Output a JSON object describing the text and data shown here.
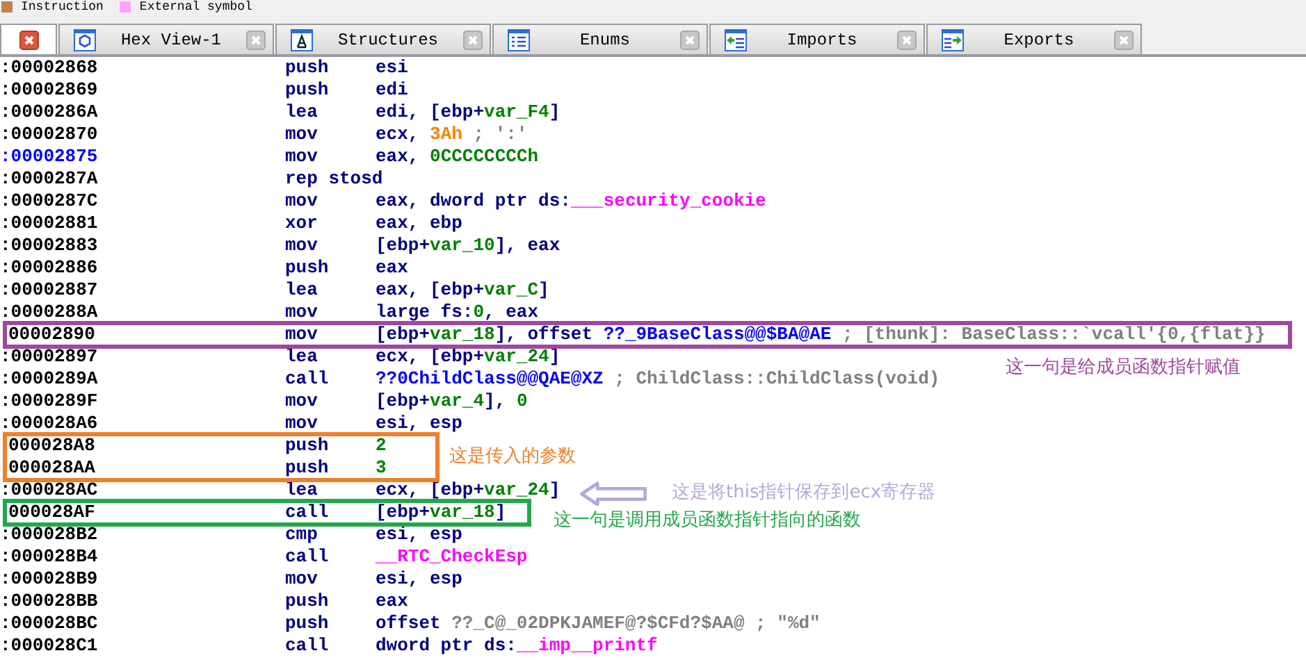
{
  "legend": [
    {
      "label": "Instruction",
      "color": "#c08050"
    },
    {
      "label": "External symbol",
      "color": "#ffa0ff"
    }
  ],
  "tabs": [
    {
      "kind": "disasm",
      "selected": true
    },
    {
      "kind": "hex",
      "label": "Hex View-1",
      "selected": false
    },
    {
      "kind": "structures",
      "label": "Structures",
      "selected": false
    },
    {
      "kind": "enums",
      "label": "Enums",
      "selected": false
    },
    {
      "kind": "imports",
      "label": "Imports",
      "selected": false
    },
    {
      "kind": "exports",
      "label": "Exports",
      "selected": false
    }
  ],
  "lines": [
    {
      "address": ":00002868",
      "kind": "plain",
      "mnemonic": "push",
      "operand": [
        {
          "kind": "reg",
          "text": "esi"
        }
      ]
    },
    {
      "address": ":00002869",
      "kind": "plain",
      "mnemonic": "push",
      "operand": [
        {
          "kind": "reg",
          "text": "edi"
        }
      ]
    },
    {
      "address": ":0000286A",
      "kind": "plain",
      "mnemonic": "lea",
      "operand": [
        {
          "kind": "reg",
          "text": "edi, [ebp+"
        },
        {
          "kind": "var",
          "text": "var_F4"
        },
        {
          "kind": "reg",
          "text": "]"
        }
      ]
    },
    {
      "address": ":00002870",
      "kind": "plain",
      "mnemonic": "mov",
      "operand": [
        {
          "kind": "reg",
          "text": "ecx, "
        },
        {
          "kind": "char",
          "text": "3Ah"
        },
        {
          "kind": "comment",
          "text": " ; ':'"
        }
      ]
    },
    {
      "address": ":00002875",
      "kind": "label",
      "mnemonic": "mov",
      "operand": [
        {
          "kind": "reg",
          "text": "eax, "
        },
        {
          "kind": "num",
          "text": "0CCCCCCCCh"
        }
      ]
    },
    {
      "address": ":0000287A",
      "kind": "plain",
      "mnemonic": "rep stosd"
    },
    {
      "address": ":0000287C",
      "kind": "plain",
      "mnemonic": "mov",
      "operand": [
        {
          "kind": "reg",
          "text": "eax, dword ptr ds:"
        },
        {
          "kind": "import",
          "text": "___security_cookie"
        }
      ]
    },
    {
      "address": ":00002881",
      "kind": "plain",
      "mnemonic": "xor",
      "operand": [
        {
          "kind": "reg",
          "text": "eax, ebp"
        }
      ]
    },
    {
      "address": ":00002883",
      "kind": "plain",
      "mnemonic": "mov",
      "operand": [
        {
          "kind": "reg",
          "text": "[ebp+"
        },
        {
          "kind": "var",
          "text": "var_10"
        },
        {
          "kind": "reg",
          "text": "], eax"
        }
      ]
    },
    {
      "address": ":00002886",
      "kind": "plain",
      "mnemonic": "push",
      "operand": [
        {
          "kind": "reg",
          "text": "eax"
        }
      ]
    },
    {
      "address": ":00002887",
      "kind": "plain",
      "mnemonic": "lea",
      "operand": [
        {
          "kind": "reg",
          "text": "eax, [ebp+"
        },
        {
          "kind": "var",
          "text": "var_C"
        },
        {
          "kind": "reg",
          "text": "]"
        }
      ]
    },
    {
      "address": ":0000288A",
      "kind": "plain",
      "mnemonic": "mov",
      "operand": [
        {
          "kind": "reg",
          "text": "large fs:"
        },
        {
          "kind": "num",
          "text": "0"
        },
        {
          "kind": "reg",
          "text": ", eax"
        }
      ]
    },
    {
      "address": "00002890",
      "kind": "plain",
      "color": "#a0479f",
      "mnemonic": "mov",
      "operand": [
        {
          "kind": "reg",
          "text": "[ebp+"
        },
        {
          "kind": "var",
          "text": "var_18"
        },
        {
          "kind": "reg",
          "text": "], offset "
        },
        {
          "kind": "name",
          "text": "??_9BaseClass@@$BA@AE"
        },
        {
          "kind": "comment",
          "text": " ; [thunk]: BaseClass::`vcall'{0,{flat}}"
        }
      ]
    },
    {
      "address": ":00002897",
      "kind": "plain",
      "mnemonic": "lea",
      "operand": [
        {
          "kind": "reg",
          "text": "ecx, [ebp+"
        },
        {
          "kind": "var",
          "text": "var_24"
        },
        {
          "kind": "reg",
          "text": "]"
        }
      ]
    },
    {
      "address": ":0000289A",
      "kind": "plain",
      "mnemonic": "call",
      "operand": [
        {
          "kind": "name",
          "text": "??0ChildClass@@QAE@XZ"
        },
        {
          "kind": "comment",
          "text": " ; ChildClass::ChildClass(void)"
        }
      ]
    },
    {
      "address": ":0000289F",
      "kind": "plain",
      "mnemonic": "mov",
      "operand": [
        {
          "kind": "reg",
          "text": "[ebp+"
        },
        {
          "kind": "var",
          "text": "var_4"
        },
        {
          "kind": "reg",
          "text": "], "
        },
        {
          "kind": "num",
          "text": "0"
        }
      ]
    },
    {
      "address": ":000028A6",
      "kind": "plain",
      "mnemonic": "mov",
      "operand": [
        {
          "kind": "reg",
          "text": "esi, esp"
        }
      ]
    },
    {
      "address": "000028A8",
      "kind": "plain",
      "color": "#f07f2a",
      "mnemonic": "push",
      "operand": [
        {
          "kind": "num",
          "text": "2"
        }
      ]
    },
    {
      "address": "000028AA",
      "kind": "plain",
      "color": "#f07f2a",
      "mnemonic": "push",
      "operand": [
        {
          "kind": "num",
          "text": "3"
        }
      ]
    },
    {
      "address": ":000028AC",
      "kind": "plain",
      "mnemonic": "lea",
      "operand": [
        {
          "kind": "reg",
          "text": "ecx, [ebp+"
        },
        {
          "kind": "var",
          "text": "var_24"
        },
        {
          "kind": "reg",
          "text": "]"
        }
      ]
    },
    {
      "address": "000028AF",
      "kind": "plain",
      "color": "#22a84a",
      "mnemonic": "call",
      "operand": [
        {
          "kind": "reg",
          "text": "[ebp+"
        },
        {
          "kind": "var",
          "text": "var_18"
        },
        {
          "kind": "reg",
          "text": "]"
        }
      ]
    },
    {
      "address": ":000028B2",
      "kind": "plain",
      "mnemonic": "cmp",
      "operand": [
        {
          "kind": "reg",
          "text": "esi, esp"
        }
      ]
    },
    {
      "address": ":000028B4",
      "kind": "plain",
      "mnemonic": "call",
      "operand": [
        {
          "kind": "import",
          "text": "__RTC_CheckEsp"
        }
      ]
    },
    {
      "address": ":000028B9",
      "kind": "plain",
      "mnemonic": "mov",
      "operand": [
        {
          "kind": "reg",
          "text": "esi, esp"
        }
      ]
    },
    {
      "address": ":000028BB",
      "kind": "plain",
      "mnemonic": "push",
      "operand": [
        {
          "kind": "reg",
          "text": "eax"
        }
      ]
    },
    {
      "address": ":000028BC",
      "kind": "plain",
      "mnemonic": "push",
      "operand": [
        {
          "kind": "reg",
          "text": "offset "
        },
        {
          "kind": "string",
          "text": "??_C@_02DPKJAMEF@?$CFd?$AA@"
        },
        {
          "kind": "comment",
          "text": " ; \"%d\""
        }
      ]
    },
    {
      "address": ":000028C1",
      "kind": "plain",
      "mnemonic": "call",
      "operand": [
        {
          "kind": "reg",
          "text": "dword ptr ds:"
        },
        {
          "kind": "import",
          "text": "__imp__printf"
        }
      ]
    }
  ],
  "annotations": [
    {
      "kind": "box",
      "color": "#a0479f",
      "note": "这一句是给成员函数指针赋值"
    },
    {
      "kind": "box",
      "color": "#f07f2a",
      "note": "这是传入的参数"
    },
    {
      "kind": "arrow",
      "color": "#b4a9d9",
      "note": "这是将this指针保存到ecx寄存器"
    },
    {
      "kind": "box",
      "color": "#22a84a",
      "note": "这一句是调用成员函数指针指向的函数"
    }
  ]
}
